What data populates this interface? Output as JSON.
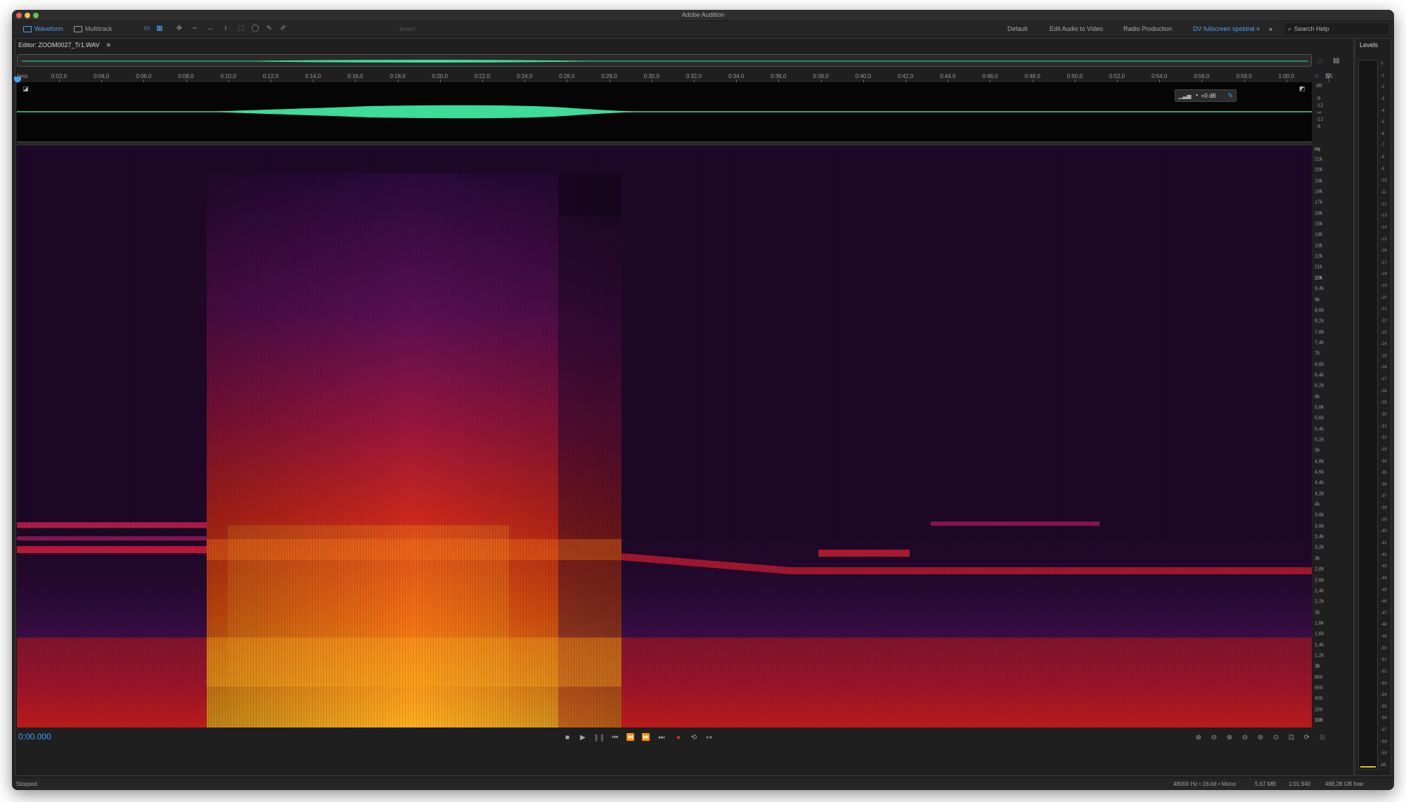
{
  "app": {
    "title": "Adobe Audition"
  },
  "toolbar": {
    "waveform_label": "Waveform",
    "multitrack_label": "Multitrack",
    "invert_label": "Invert",
    "workspaces": [
      "Default",
      "Edit Audio to Video",
      "Radio Production",
      "DV fullscreen spektral"
    ],
    "active_workspace": "DV fullscreen spektral",
    "more_label": "»",
    "search_placeholder": "Search Help"
  },
  "editor": {
    "tab_label": "Editor: ZOOM0027_Tr1.WAV",
    "tab_menu_icon": "≡",
    "time_unit": "hms",
    "time_ticks": [
      "0:02,0",
      "0:04,0",
      "0:06,0",
      "0:08,0",
      "0:10,0",
      "0:12,0",
      "0:14,0",
      "0:16,0",
      "0:18,0",
      "0:20,0",
      "0:22,0",
      "0:24,0",
      "0:26,0",
      "0:28,0",
      "0:30,0",
      "0:32,0",
      "0:34,0",
      "0:36,0",
      "0:38,0",
      "0:40,0",
      "0:42,0",
      "0:44,0",
      "0:46,0",
      "0:48,0",
      "0:50,0",
      "0:52,0",
      "0:54,0",
      "0:56,0",
      "0:58,0",
      "1:00,0",
      "1:0"
    ],
    "amplitude_scale": [
      "dB",
      "-6",
      "-12",
      "-∞",
      "-12",
      "-6"
    ],
    "volume_label": "+0 dB",
    "frequency_unit": "Hz",
    "frequency_labels": [
      {
        "label": "21k",
        "major": false
      },
      {
        "label": "20k",
        "major": false
      },
      {
        "label": "19k",
        "major": false
      },
      {
        "label": "18k",
        "major": false
      },
      {
        "label": "17k",
        "major": false
      },
      {
        "label": "16k",
        "major": false
      },
      {
        "label": "15k",
        "major": false
      },
      {
        "label": "14k",
        "major": false
      },
      {
        "label": "13k",
        "major": false
      },
      {
        "label": "12k",
        "major": false
      },
      {
        "label": "11k",
        "major": false
      },
      {
        "label": "10k",
        "major": true
      },
      {
        "label": "9,4k",
        "major": false
      },
      {
        "label": "9k",
        "major": false
      },
      {
        "label": "8,6k",
        "major": false
      },
      {
        "label": "8,2k",
        "major": false
      },
      {
        "label": "7,8k",
        "major": false
      },
      {
        "label": "7,4k",
        "major": false
      },
      {
        "label": "7k",
        "major": false
      },
      {
        "label": "6,6k",
        "major": false
      },
      {
        "label": "6,4k",
        "major": false
      },
      {
        "label": "6,2k",
        "major": false
      },
      {
        "label": "6k",
        "major": false
      },
      {
        "label": "5,8k",
        "major": false
      },
      {
        "label": "5,6k",
        "major": false
      },
      {
        "label": "5,4k",
        "major": false
      },
      {
        "label": "5,2k",
        "major": false
      },
      {
        "label": "5k",
        "major": false
      },
      {
        "label": "4,8k",
        "major": false
      },
      {
        "label": "4,6k",
        "major": false
      },
      {
        "label": "4,4k",
        "major": false
      },
      {
        "label": "4,2k",
        "major": false
      },
      {
        "label": "4k",
        "major": false
      },
      {
        "label": "3,8k",
        "major": false
      },
      {
        "label": "3,6k",
        "major": false
      },
      {
        "label": "3,4k",
        "major": false
      },
      {
        "label": "3,2k",
        "major": false
      },
      {
        "label": "3k",
        "major": false
      },
      {
        "label": "2,8k",
        "major": false
      },
      {
        "label": "2,6k",
        "major": false
      },
      {
        "label": "2,4k",
        "major": false
      },
      {
        "label": "2,2k",
        "major": false
      },
      {
        "label": "2k",
        "major": false
      },
      {
        "label": "1,8k",
        "major": false
      },
      {
        "label": "1,6k",
        "major": false
      },
      {
        "label": "1,4k",
        "major": false
      },
      {
        "label": "1,2k",
        "major": false
      },
      {
        "label": "1k",
        "major": true
      },
      {
        "label": "800",
        "major": false
      },
      {
        "label": "600",
        "major": false
      },
      {
        "label": "400",
        "major": false
      },
      {
        "label": "200",
        "major": false
      },
      {
        "label": "100",
        "major": true
      }
    ]
  },
  "transport": {
    "current_time": "0:00.000"
  },
  "levels": {
    "title": "Levels",
    "scale": [
      "0",
      "-1",
      "-2",
      "-3",
      "-4",
      "-5",
      "-6",
      "-7",
      "-8",
      "-9",
      "-10",
      "-11",
      "-12",
      "-13",
      "-14",
      "-15",
      "-16",
      "-17",
      "-18",
      "-19",
      "-20",
      "-21",
      "-22",
      "-23",
      "-24",
      "-25",
      "-26",
      "-27",
      "-28",
      "-29",
      "-30",
      "-31",
      "-32",
      "-33",
      "-34",
      "-35",
      "-36",
      "-37",
      "-38",
      "-39",
      "-40",
      "-41",
      "-42",
      "-43",
      "-44",
      "-45",
      "-46",
      "-47",
      "-48",
      "-49",
      "-50",
      "-51",
      "-52",
      "-53",
      "-54",
      "-55",
      "-56",
      "-57",
      "-58",
      "-59",
      "dB"
    ]
  },
  "status": {
    "state": "Stopped",
    "format": "48000 Hz • 16-bit • Mono",
    "file_size": "5,67 MB",
    "duration": "1:01.940",
    "free_space": "488,28 GB free"
  },
  "colors": {
    "accent": "#4d9cf0",
    "waveform": "#3ddc97",
    "record": "#e0302a",
    "spectral_low": "#1e0828",
    "spectral_high": "#ffb020"
  }
}
